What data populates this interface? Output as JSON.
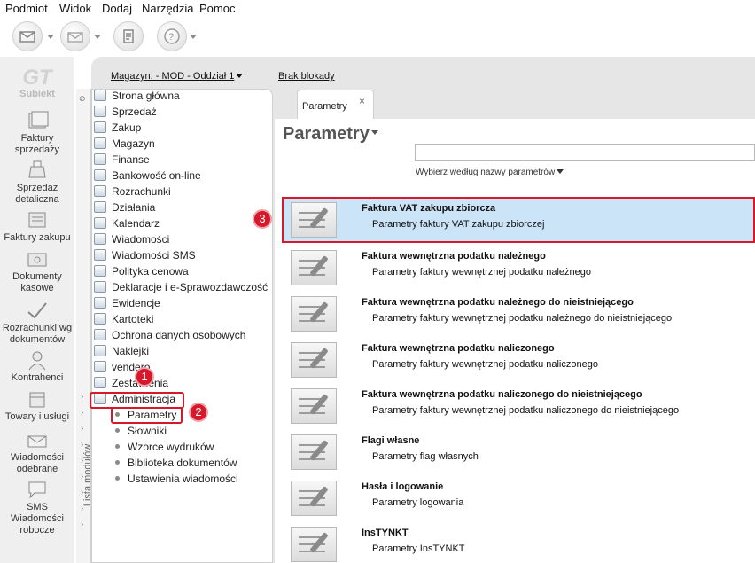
{
  "menu": [
    "Podmiot",
    "Widok",
    "Dodaj",
    "Narzędzia",
    "Pomoc"
  ],
  "app_logo": "Subiekt",
  "modules": [
    {
      "label": "Faktury sprzedaży",
      "icon": "invoice-stack-icon"
    },
    {
      "label": "Sprzedaż detaliczna",
      "icon": "cash-register-icon"
    },
    {
      "label": "Faktury zakupu",
      "icon": "purchase-invoice-icon"
    },
    {
      "label": "Dokumenty kasowe",
      "icon": "cash-document-icon"
    },
    {
      "label": "Rozrachunki wg dokumentów",
      "icon": "settlement-icon"
    },
    {
      "label": "Kontrahenci",
      "icon": "contractor-icon"
    },
    {
      "label": "Towary i usługi",
      "icon": "goods-icon"
    },
    {
      "label": "Wiadomości odebrane",
      "icon": "received-messages-icon"
    },
    {
      "label": "SMS Wiadomości robocze",
      "icon": "sms-draft-icon"
    }
  ],
  "header": {
    "magazyn": "Magazyn: - MOD - Oddział 1",
    "brak_blokady": "Brak blokady"
  },
  "module_list_label": "Lista modułów",
  "nav": [
    "Strona główna",
    "Sprzedaż",
    "Zakup",
    "Magazyn",
    "Finanse",
    "Bankowość on-line",
    "Rozrachunki",
    "Działania",
    "Kalendarz",
    "Wiadomości",
    "Wiadomości SMS",
    "Polityka cenowa",
    "Deklaracje i e-Sprawozdawczość",
    "Ewidencje",
    "Kartoteki",
    "Ochrona danych osobowych",
    "Naklejki",
    "vendero",
    "Zestawienia",
    "Administracja"
  ],
  "subnav": [
    "Parametry",
    "Słowniki",
    "Wzorce wydruków",
    "Biblioteka dokumentów",
    "Ustawienia wiadomości"
  ],
  "badges": [
    "1",
    "2",
    "3"
  ],
  "tab": {
    "label": "Parametry",
    "close": "×"
  },
  "page": {
    "title": "Parametry",
    "search_value": "",
    "filter_link": "Wybierz według nazwy parametrów"
  },
  "params": [
    {
      "title": "Faktura VAT zakupu zbiorcza",
      "desc": "Parametry faktury VAT zakupu zbiorczej"
    },
    {
      "title": "Faktura wewnętrzna podatku należnego",
      "desc": "Parametry faktury wewnętrznej podatku należnego"
    },
    {
      "title": "Faktura wewnętrzna podatku należnego do nieistniejącego",
      "desc": "Parametry faktury wewnętrznej podatku należnego do nieistniejącego"
    },
    {
      "title": "Faktura wewnętrzna podatku naliczonego",
      "desc": "Parametry faktury wewnętrznej podatku naliczonego"
    },
    {
      "title": "Faktura wewnętrzna podatku naliczonego do nieistniejącego",
      "desc": "Parametry faktury wewnętrznej podatku naliczonego do nieistniejącego"
    },
    {
      "title": "Flagi własne",
      "desc": "Parametry flag własnych"
    },
    {
      "title": "Hasła i logowanie",
      "desc": "Parametry logowania"
    },
    {
      "title": "InsTYNKT",
      "desc": "Parametry InsTYNKT"
    }
  ],
  "colors": {
    "highlight_red": "#d7182a",
    "selected_row": "#cce4f7"
  }
}
